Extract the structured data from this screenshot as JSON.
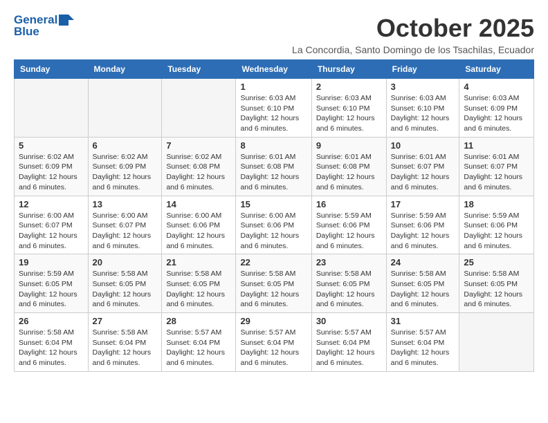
{
  "header": {
    "logo_line1": "General",
    "logo_line2": "Blue",
    "month": "October 2025",
    "location": "La Concordia, Santo Domingo de los Tsachilas, Ecuador"
  },
  "weekdays": [
    "Sunday",
    "Monday",
    "Tuesday",
    "Wednesday",
    "Thursday",
    "Friday",
    "Saturday"
  ],
  "weeks": [
    [
      {
        "day": "",
        "info": ""
      },
      {
        "day": "",
        "info": ""
      },
      {
        "day": "",
        "info": ""
      },
      {
        "day": "1",
        "info": "Sunrise: 6:03 AM\nSunset: 6:10 PM\nDaylight: 12 hours and 6 minutes."
      },
      {
        "day": "2",
        "info": "Sunrise: 6:03 AM\nSunset: 6:10 PM\nDaylight: 12 hours and 6 minutes."
      },
      {
        "day": "3",
        "info": "Sunrise: 6:03 AM\nSunset: 6:10 PM\nDaylight: 12 hours and 6 minutes."
      },
      {
        "day": "4",
        "info": "Sunrise: 6:03 AM\nSunset: 6:09 PM\nDaylight: 12 hours and 6 minutes."
      }
    ],
    [
      {
        "day": "5",
        "info": "Sunrise: 6:02 AM\nSunset: 6:09 PM\nDaylight: 12 hours and 6 minutes."
      },
      {
        "day": "6",
        "info": "Sunrise: 6:02 AM\nSunset: 6:09 PM\nDaylight: 12 hours and 6 minutes."
      },
      {
        "day": "7",
        "info": "Sunrise: 6:02 AM\nSunset: 6:08 PM\nDaylight: 12 hours and 6 minutes."
      },
      {
        "day": "8",
        "info": "Sunrise: 6:01 AM\nSunset: 6:08 PM\nDaylight: 12 hours and 6 minutes."
      },
      {
        "day": "9",
        "info": "Sunrise: 6:01 AM\nSunset: 6:08 PM\nDaylight: 12 hours and 6 minutes."
      },
      {
        "day": "10",
        "info": "Sunrise: 6:01 AM\nSunset: 6:07 PM\nDaylight: 12 hours and 6 minutes."
      },
      {
        "day": "11",
        "info": "Sunrise: 6:01 AM\nSunset: 6:07 PM\nDaylight: 12 hours and 6 minutes."
      }
    ],
    [
      {
        "day": "12",
        "info": "Sunrise: 6:00 AM\nSunset: 6:07 PM\nDaylight: 12 hours and 6 minutes."
      },
      {
        "day": "13",
        "info": "Sunrise: 6:00 AM\nSunset: 6:07 PM\nDaylight: 12 hours and 6 minutes."
      },
      {
        "day": "14",
        "info": "Sunrise: 6:00 AM\nSunset: 6:06 PM\nDaylight: 12 hours and 6 minutes."
      },
      {
        "day": "15",
        "info": "Sunrise: 6:00 AM\nSunset: 6:06 PM\nDaylight: 12 hours and 6 minutes."
      },
      {
        "day": "16",
        "info": "Sunrise: 5:59 AM\nSunset: 6:06 PM\nDaylight: 12 hours and 6 minutes."
      },
      {
        "day": "17",
        "info": "Sunrise: 5:59 AM\nSunset: 6:06 PM\nDaylight: 12 hours and 6 minutes."
      },
      {
        "day": "18",
        "info": "Sunrise: 5:59 AM\nSunset: 6:06 PM\nDaylight: 12 hours and 6 minutes."
      }
    ],
    [
      {
        "day": "19",
        "info": "Sunrise: 5:59 AM\nSunset: 6:05 PM\nDaylight: 12 hours and 6 minutes."
      },
      {
        "day": "20",
        "info": "Sunrise: 5:58 AM\nSunset: 6:05 PM\nDaylight: 12 hours and 6 minutes."
      },
      {
        "day": "21",
        "info": "Sunrise: 5:58 AM\nSunset: 6:05 PM\nDaylight: 12 hours and 6 minutes."
      },
      {
        "day": "22",
        "info": "Sunrise: 5:58 AM\nSunset: 6:05 PM\nDaylight: 12 hours and 6 minutes."
      },
      {
        "day": "23",
        "info": "Sunrise: 5:58 AM\nSunset: 6:05 PM\nDaylight: 12 hours and 6 minutes."
      },
      {
        "day": "24",
        "info": "Sunrise: 5:58 AM\nSunset: 6:05 PM\nDaylight: 12 hours and 6 minutes."
      },
      {
        "day": "25",
        "info": "Sunrise: 5:58 AM\nSunset: 6:05 PM\nDaylight: 12 hours and 6 minutes."
      }
    ],
    [
      {
        "day": "26",
        "info": "Sunrise: 5:58 AM\nSunset: 6:04 PM\nDaylight: 12 hours and 6 minutes."
      },
      {
        "day": "27",
        "info": "Sunrise: 5:58 AM\nSunset: 6:04 PM\nDaylight: 12 hours and 6 minutes."
      },
      {
        "day": "28",
        "info": "Sunrise: 5:57 AM\nSunset: 6:04 PM\nDaylight: 12 hours and 6 minutes."
      },
      {
        "day": "29",
        "info": "Sunrise: 5:57 AM\nSunset: 6:04 PM\nDaylight: 12 hours and 6 minutes."
      },
      {
        "day": "30",
        "info": "Sunrise: 5:57 AM\nSunset: 6:04 PM\nDaylight: 12 hours and 6 minutes."
      },
      {
        "day": "31",
        "info": "Sunrise: 5:57 AM\nSunset: 6:04 PM\nDaylight: 12 hours and 6 minutes."
      },
      {
        "day": "",
        "info": ""
      }
    ]
  ]
}
